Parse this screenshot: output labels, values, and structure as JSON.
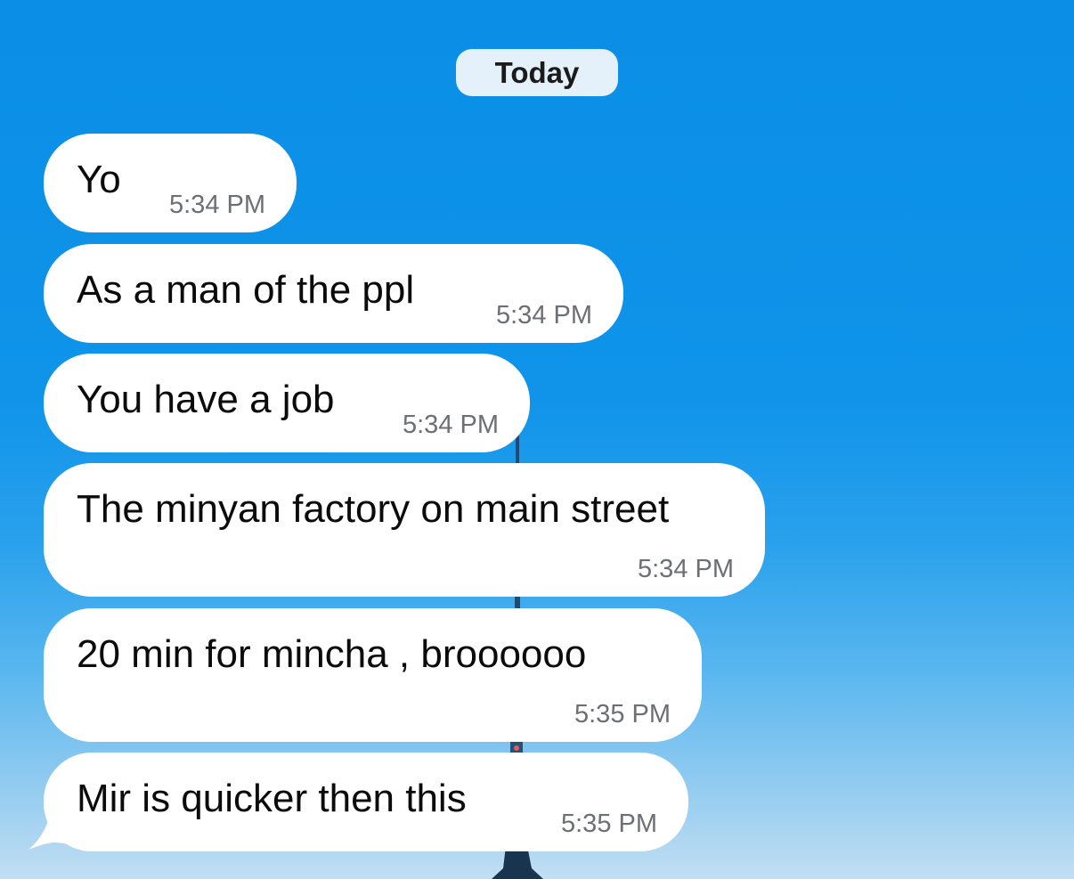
{
  "chat": {
    "date_label": "Today",
    "messages": [
      {
        "text": "Yo",
        "time": "5:34 PM"
      },
      {
        "text": "As a man of the ppl",
        "time": "5:34 PM"
      },
      {
        "text": "You have a job",
        "time": "5:34 PM"
      },
      {
        "text": "The minyan factory on main street",
        "time": "5:34 PM"
      },
      {
        "text": "20 min for mincha , broooooo",
        "time": "5:35 PM"
      },
      {
        "text": "Mir is quicker then this",
        "time": "5:35 PM"
      }
    ]
  },
  "colors": {
    "bubble": "#ffffff",
    "date_pill": "#e4f1fb",
    "timestamp": "#6c6f73",
    "background_top": "#0a8ee6",
    "background_bottom": "#c2def2"
  }
}
